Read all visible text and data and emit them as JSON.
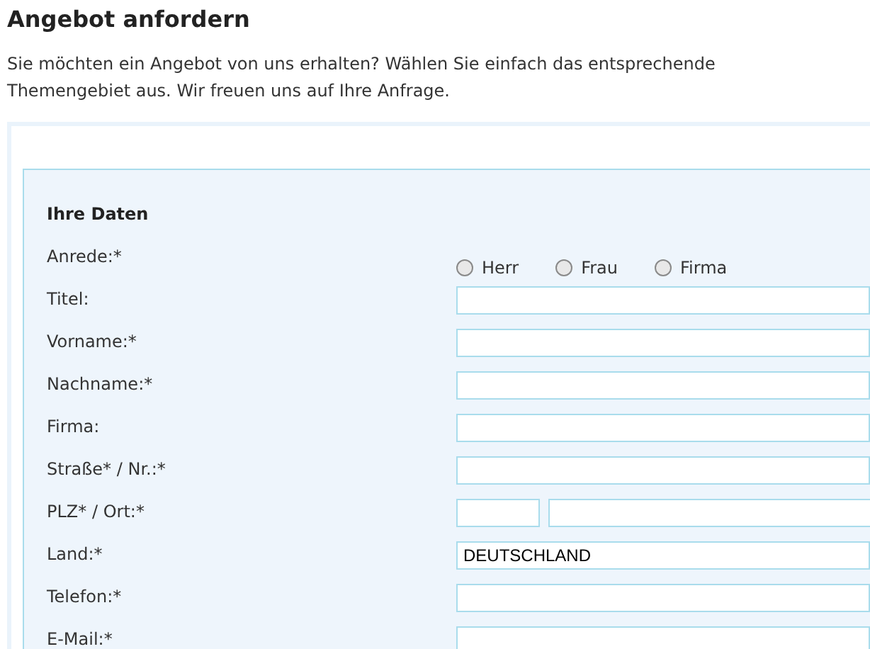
{
  "title": "Angebot anfordern",
  "intro": "Sie möchten ein Angebot von uns erhalten? Wählen Sie einfach das entsprechende Themengebiet aus. Wir freuen uns auf Ihre Anfrage.",
  "section": {
    "title": "Ihre Daten",
    "fields": [
      {
        "kind": "radio",
        "label": "Anrede:*",
        "options": [
          {
            "label": "Herr",
            "selected": false
          },
          {
            "label": "Frau",
            "selected": false
          },
          {
            "label": "Firma",
            "selected": false
          }
        ]
      },
      {
        "kind": "text",
        "label": "Titel:"
      },
      {
        "kind": "text",
        "label": "Vorname:*"
      },
      {
        "kind": "text",
        "label": "Nachname:*"
      },
      {
        "kind": "text",
        "label": "Firma:"
      },
      {
        "kind": "text",
        "label": "Straße* / Nr.:*"
      },
      {
        "kind": "split",
        "label": "PLZ* / Ort:*"
      },
      {
        "kind": "text",
        "label": "Land:*",
        "value": "DEUTSCHLAND"
      },
      {
        "kind": "text",
        "label": "Telefon:*"
      },
      {
        "kind": "text",
        "label": "E-Mail:*"
      }
    ]
  }
}
